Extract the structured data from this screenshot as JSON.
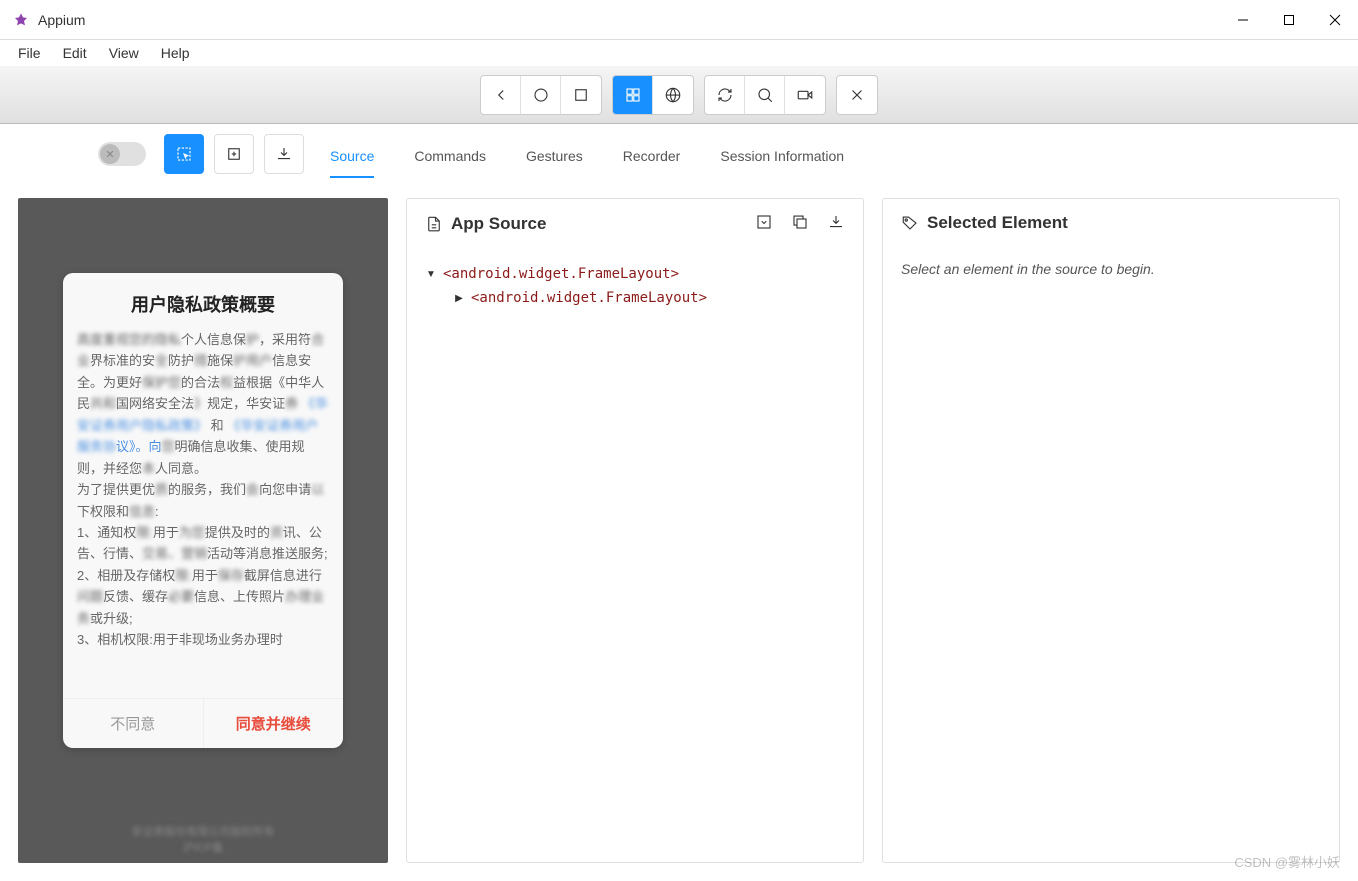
{
  "window": {
    "title": "Appium"
  },
  "menubar": {
    "items": [
      "File",
      "Edit",
      "View",
      "Help"
    ]
  },
  "tabs": {
    "items": [
      "Source",
      "Commands",
      "Gestures",
      "Recorder",
      "Session Information"
    ],
    "active_index": 0
  },
  "source_panel": {
    "title": "App Source",
    "tree": {
      "root_label": "<android.widget.FrameLayout>",
      "child_label": "<android.widget.FrameLayout>"
    }
  },
  "selected_panel": {
    "title": "Selected Element",
    "hint": "Select an element in the source to begin."
  },
  "device_dialog": {
    "title": "用户隐私政策概要",
    "body_p1a": "个人信息保",
    "body_p1b": "，采用符",
    "body_p1c": "界标准的安",
    "body_p1d": "防护",
    "body_p1e": "施保",
    "body_p1f": "信息安全。为更好",
    "body_p1g": "的合法",
    "body_p1h": "益根据《中华人民",
    "body_p1i": "国网络安全法",
    "body_p1j": "规定，华安证",
    "body_link1": "《",
    "body_link2": "》",
    "body_mid1": " 和 ",
    "body_p2a": "议》。向",
    "body_p2b": "明确信息收集、使用规则，并经您",
    "body_p2c": "人同意。",
    "body_p3": "为了提供更优",
    "body_p3b": "的服务，我们",
    "body_p3c": "向您申请",
    "body_p3d": "下权限和",
    "body_item1a": "1、通知权",
    "body_item1b": "用于",
    "body_item1c": "提供及时的",
    "body_item1d": "讯、公告、行情、",
    "body_item1e": "活动等消息推送服务;",
    "body_item2a": "2、相册及存储权",
    "body_item2b": "用于",
    "body_item2c": "截屏信息进行",
    "body_item2d": "反馈、缓存",
    "body_item2e": "信息、上传照片",
    "body_item2f": "或升级;",
    "body_item3": "3、相机权限:用于非现场业务办理时",
    "btn_cancel": "不同意",
    "btn_ok": "同意并继续",
    "bg_footer_line1": "安证券股份有限公司版权所有",
    "bg_footer_line2": "沪ICP备"
  },
  "watermark": "CSDN @雾林小妖"
}
